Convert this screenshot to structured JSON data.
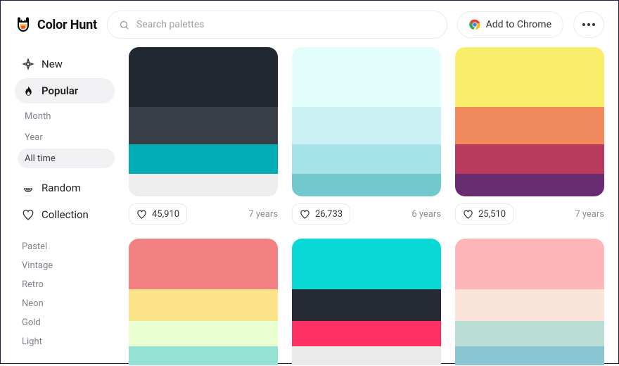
{
  "brand": {
    "name": "Color Hunt"
  },
  "search": {
    "placeholder": "Search palettes"
  },
  "header": {
    "chrome_label": "Add to Chrome"
  },
  "sidebar": {
    "nav": [
      {
        "id": "new",
        "label": "New",
        "icon": "sparkle-diamond-icon",
        "active": false
      },
      {
        "id": "popular",
        "label": "Popular",
        "icon": "flame-icon",
        "active": true
      },
      {
        "id": "random",
        "label": "Random",
        "icon": "spiral-icon",
        "active": false
      },
      {
        "id": "collection",
        "label": "Collection",
        "icon": "heart-outline-icon",
        "active": false
      }
    ],
    "popular_sub": [
      {
        "id": "month",
        "label": "Month",
        "active": false
      },
      {
        "id": "year",
        "label": "Year",
        "active": false
      },
      {
        "id": "alltime",
        "label": "All time",
        "active": true
      }
    ],
    "tags": [
      "Pastel",
      "Vintage",
      "Retro",
      "Neon",
      "Gold",
      "Light"
    ]
  },
  "palettes": [
    {
      "colors": [
        "#222831",
        "#393E46",
        "#00ADB5",
        "#EEEEEE"
      ],
      "likes": "45,910",
      "age": "7 years"
    },
    {
      "colors": [
        "#E3FDFD",
        "#CBF1F5",
        "#A6E3E9",
        "#71C9CE"
      ],
      "likes": "26,733",
      "age": "6 years"
    },
    {
      "colors": [
        "#F9ED69",
        "#F08A5D",
        "#B83B5E",
        "#6A2C70"
      ],
      "likes": "25,510",
      "age": "7 years"
    },
    {
      "colors": [
        "#F38181",
        "#FCE38A",
        "#EAFFD0",
        "#95E1D3"
      ],
      "likes": "",
      "age": ""
    },
    {
      "colors": [
        "#08D9D6",
        "#252A34",
        "#FF2E63",
        "#EAEAEA"
      ],
      "likes": "",
      "age": ""
    },
    {
      "colors": [
        "#FFB6B9",
        "#FAE3D9",
        "#BBDED6",
        "#8AC6D1"
      ],
      "likes": "",
      "age": ""
    }
  ]
}
